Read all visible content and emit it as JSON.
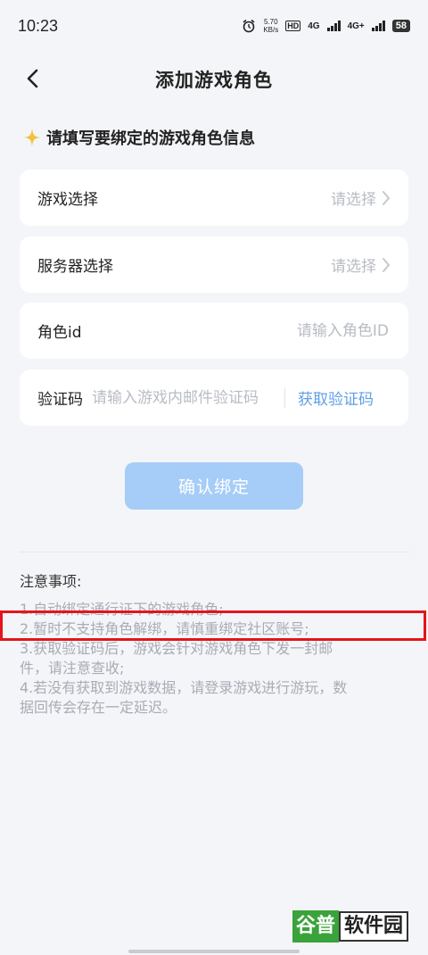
{
  "status": {
    "time": "10:23",
    "net_speed": "5.70",
    "net_unit": "KB/s",
    "hd": "HD",
    "net1": "4G",
    "net2": "4G+",
    "battery": "58"
  },
  "nav": {
    "title": "添加游戏角色"
  },
  "section": {
    "heading": "请填写要绑定的游戏角色信息"
  },
  "form": {
    "game": {
      "label": "游戏选择",
      "value": "请选择"
    },
    "server": {
      "label": "服务器选择",
      "value": "请选择"
    },
    "role": {
      "label": "角色id",
      "placeholder": "请输入角色ID"
    },
    "code": {
      "label": "验证码",
      "placeholder": "请输入游戏内邮件验证码",
      "action": "获取验证码"
    }
  },
  "confirm_label": "确认绑定",
  "notes": {
    "title": "注意事项:",
    "lines": [
      "1.自动绑定通行证下的游戏角色;",
      "2.暂时不支持角色解绑，请慎重绑定社区账号;",
      "3.获取验证码后，游戏会针对游戏角色下发一封邮",
      "件，请注意查收;",
      "4.若没有获取到游戏数据，请登录游戏进行游玩，数",
      "据回传会存在一定延迟。"
    ]
  },
  "watermark": {
    "part1": "谷普",
    "part2": "软件园"
  },
  "colors": {
    "accent": "#5f9fe6",
    "button": "#a6cdf7",
    "highlight": "#e5141c",
    "star": "#f2c23c"
  }
}
